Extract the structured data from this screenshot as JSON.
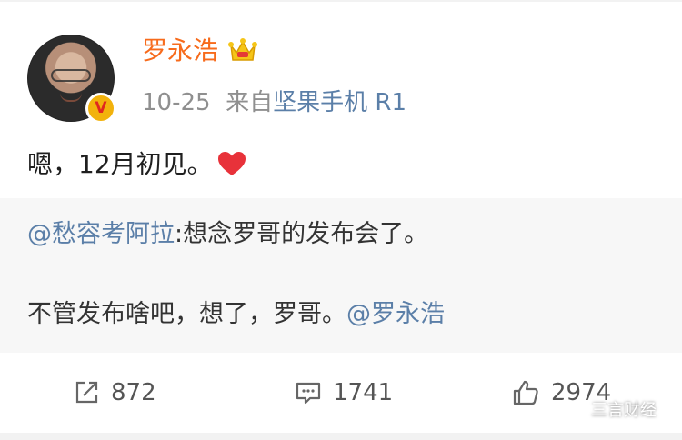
{
  "post": {
    "author": "罗永浩",
    "date": "10-25",
    "source_prefix": "来自",
    "source": "坚果手机 R1",
    "content": "嗯，12月初见。",
    "badge": "V"
  },
  "repost": {
    "mention_user": "@愁容考阿拉",
    "mention_text": ":想念罗哥的发布会了。",
    "line2_text": "不管发布啥吧，想了，罗哥。",
    "line2_mention": "@罗永浩"
  },
  "actions": {
    "shares": "872",
    "comments": "1741",
    "likes": "2974"
  },
  "watermark": "三言财经",
  "colors": {
    "name": "#f76b1c",
    "link": "#5b7fa8",
    "meta": "#8f8f8f",
    "repost_bg": "#f7f7f7",
    "heart": "#e8323a"
  }
}
